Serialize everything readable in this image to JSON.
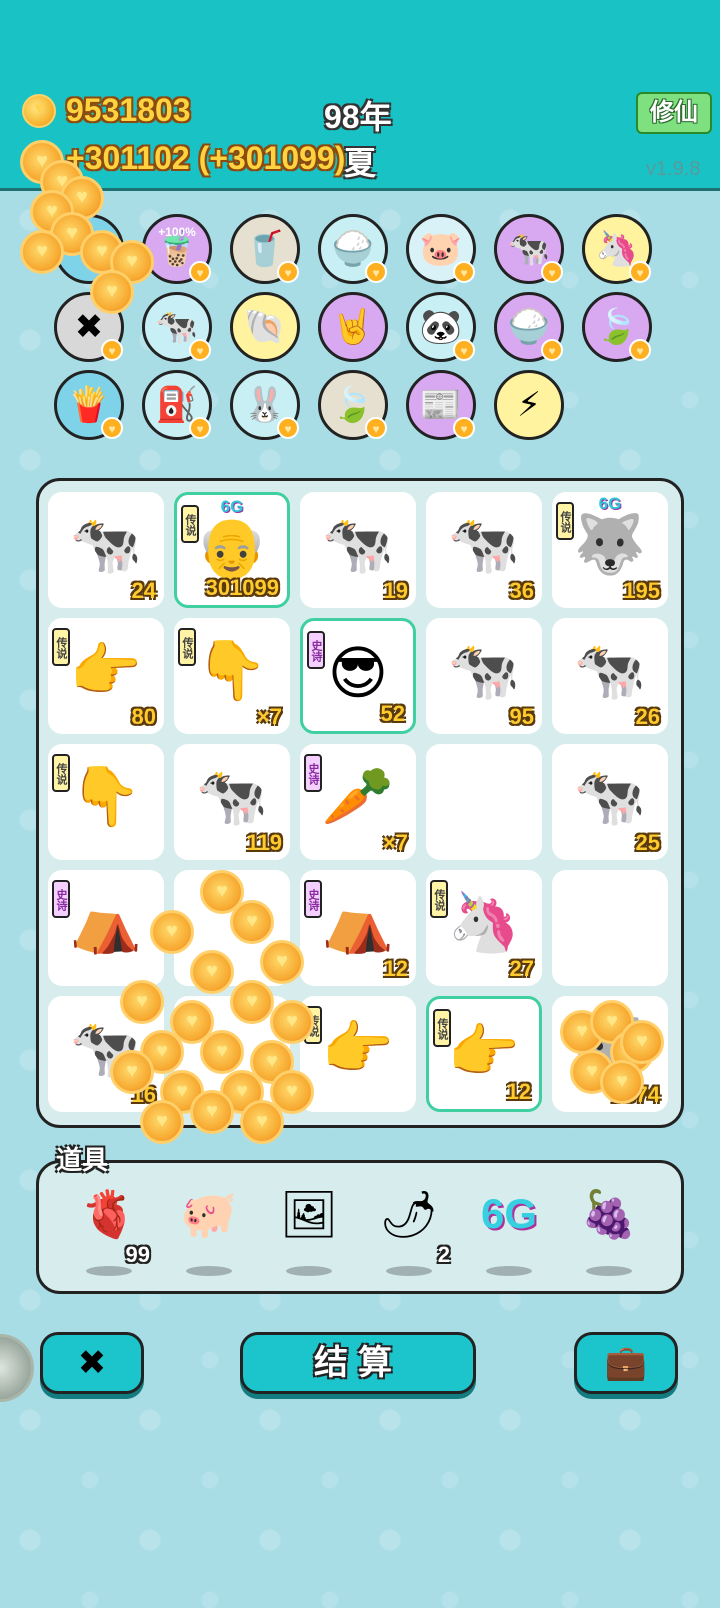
{
  "header": {
    "money": "9531803",
    "income": "+301102 (+301099)",
    "year": "98年",
    "season": "夏",
    "cultivate_button": "修仙",
    "version": "v1.9.8"
  },
  "buffs": [
    {
      "name": "cow-pair-buff",
      "icon": "🐄",
      "pct": ""
    },
    {
      "name": "milk-tea-buff",
      "icon": "🧋",
      "pct": "+100%"
    },
    {
      "name": "bubble-tea-buff",
      "icon": "🥤",
      "pct": ""
    },
    {
      "name": "rice-bowl-buff",
      "icon": "🍚",
      "pct": ""
    },
    {
      "name": "piggy-bank-buff",
      "icon": "🐷",
      "pct": ""
    },
    {
      "name": "cow-duo-buff",
      "icon": "🐄",
      "pct": ""
    },
    {
      "name": "unicorn-buff",
      "icon": "🦄",
      "pct": ""
    },
    {
      "name": "delete-tag-buff",
      "icon": "✖",
      "pct": ""
    },
    {
      "name": "cow-pair-buff-2",
      "icon": "🐄",
      "pct": ""
    },
    {
      "name": "shell-buff",
      "icon": "🐚",
      "pct": ""
    },
    {
      "name": "rock-hand-buff",
      "icon": "🤘",
      "pct": ""
    },
    {
      "name": "panda-buff",
      "icon": "🐼",
      "pct": ""
    },
    {
      "name": "rice-bowl-buff-2",
      "icon": "🍚",
      "pct": ""
    },
    {
      "name": "leaf-buff",
      "icon": "🍃",
      "pct": ""
    },
    {
      "name": "fries-buff",
      "icon": "🍟",
      "pct": ""
    },
    {
      "name": "pump-buff",
      "icon": "⛽",
      "pct": ""
    },
    {
      "name": "rabbit-buff",
      "icon": "🐰",
      "pct": ""
    },
    {
      "name": "leaf-buff-2",
      "icon": "🍃",
      "pct": ""
    },
    {
      "name": "time-magazine-buff",
      "icon": "📰",
      "pct": ""
    },
    {
      "name": "lightning-buff",
      "icon": "⚡",
      "pct": ""
    }
  ],
  "board": [
    {
      "name": "cow",
      "icon": "🐄",
      "count": "24",
      "tag": "",
      "sixg": "",
      "hl": false
    },
    {
      "name": "bald-man",
      "icon": "👴",
      "count": "301099",
      "tag": "传说",
      "sixg": "6G",
      "hl": true
    },
    {
      "name": "cow",
      "icon": "🐄",
      "count": "19",
      "tag": "",
      "sixg": "",
      "hl": false
    },
    {
      "name": "cow",
      "icon": "🐄",
      "count": "36",
      "tag": "",
      "sixg": "",
      "hl": false
    },
    {
      "name": "husky",
      "icon": "🐺",
      "count": "195",
      "tag": "传说",
      "sixg": "6G",
      "hl": false
    },
    {
      "name": "pointing-hand",
      "icon": "👉",
      "count": "80",
      "tag": "传说",
      "sixg": "",
      "hl": false
    },
    {
      "name": "pointing-hand",
      "icon": "👇",
      "count": "×7",
      "tag": "传说",
      "sixg": "",
      "hl": false
    },
    {
      "name": "green-hat-man",
      "icon": "😎",
      "count": "52",
      "tag": "史诗",
      "sixg": "",
      "hl": true
    },
    {
      "name": "cow",
      "icon": "🐄",
      "count": "95",
      "tag": "",
      "sixg": "",
      "hl": false
    },
    {
      "name": "cow",
      "icon": "🐄",
      "count": "26",
      "tag": "",
      "sixg": "",
      "hl": false
    },
    {
      "name": "pointing-hand",
      "icon": "👇",
      "count": "",
      "tag": "传说",
      "sixg": "",
      "hl": false
    },
    {
      "name": "cow",
      "icon": "🐄",
      "count": "119",
      "tag": "",
      "sixg": "",
      "hl": false
    },
    {
      "name": "carrot",
      "icon": "🥕",
      "count": "×7",
      "tag": "史诗",
      "sixg": "",
      "hl": false
    },
    {
      "name": "empty",
      "icon": "",
      "count": "",
      "tag": "",
      "sixg": "",
      "hl": false
    },
    {
      "name": "cow",
      "icon": "🐄",
      "count": "25",
      "tag": "",
      "sixg": "",
      "hl": false
    },
    {
      "name": "rabbit-tent",
      "icon": "⛺",
      "count": "",
      "tag": "史诗",
      "sixg": "",
      "hl": false
    },
    {
      "name": "coin-cover",
      "icon": "",
      "count": "",
      "tag": "",
      "sixg": "",
      "hl": false
    },
    {
      "name": "rabbit-tent",
      "icon": "⛺",
      "count": "12",
      "tag": "史诗",
      "sixg": "",
      "hl": false
    },
    {
      "name": "unicorn",
      "icon": "🦄",
      "count": "27",
      "tag": "传说",
      "sixg": "",
      "hl": false
    },
    {
      "name": "empty",
      "icon": "",
      "count": "",
      "tag": "",
      "sixg": "",
      "hl": false
    },
    {
      "name": "cow",
      "icon": "🐄",
      "count": "16",
      "tag": "",
      "sixg": "",
      "hl": false
    },
    {
      "name": "coin-cover",
      "icon": "",
      "count": "",
      "tag": "",
      "sixg": "",
      "hl": false
    },
    {
      "name": "pointing-hand",
      "icon": "👉",
      "count": "",
      "tag": "传说",
      "sixg": "",
      "hl": false
    },
    {
      "name": "pointing-hand",
      "icon": "👉",
      "count": "12",
      "tag": "传说",
      "sixg": "",
      "hl": true
    },
    {
      "name": "husky",
      "icon": "🐺",
      "count": "1374",
      "tag": "",
      "sixg": "",
      "hl": false
    }
  ],
  "tools": {
    "label": "道具",
    "items": [
      {
        "name": "liver-tool",
        "icon": "🫀",
        "qty": "99"
      },
      {
        "name": "piggy-tool",
        "icon": "🐖",
        "qty": ""
      },
      {
        "name": "panda-frame-tool",
        "icon": "🖼",
        "qty": ""
      },
      {
        "name": "chili-tool",
        "icon": "🌶",
        "qty": "2"
      },
      {
        "name": "sixg-tool",
        "icon": "6G",
        "qty": ""
      },
      {
        "name": "lychee-tool",
        "icon": "🍇",
        "qty": ""
      }
    ]
  },
  "buttons": {
    "settle": "结算",
    "delete_icon": "✖",
    "bag_icon": "💼"
  }
}
